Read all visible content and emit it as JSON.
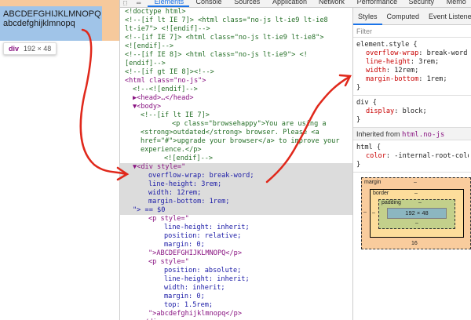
{
  "preview": {
    "line1": "ABCDEFGHIJKLMNOPQ",
    "line2": "abcdefghijklmnopq",
    "tooltip_tag": "div",
    "tooltip_size": "192 × 48"
  },
  "tabs": [
    "Elements",
    "Console",
    "Sources",
    "Application",
    "Network",
    "Performance",
    "Security",
    "Memo"
  ],
  "active_tab": "Elements",
  "dom_lines": [
    {
      "t": "<!doctype html>",
      "c": "cmt",
      "i": 0
    },
    {
      "t": "<!--[if lt IE 7]>      <html class=\"no-js lt-ie9 lt-ie8",
      "c": "cmt",
      "i": 0
    },
    {
      "t": "lt-ie7\"> <![endif]-->",
      "c": "cmt",
      "i": 0
    },
    {
      "t": "<!--[if IE 7]>         <html class=\"no-js lt-ie9 lt-ie8\">",
      "c": "cmt",
      "i": 0
    },
    {
      "t": "<![endif]-->",
      "c": "cmt",
      "i": 0
    },
    {
      "t": "<!--[if IE 8]>         <html class=\"no-js lt-ie9\"> <!",
      "c": "cmt",
      "i": 0
    },
    {
      "t": "[endif]-->",
      "c": "cmt",
      "i": 0
    },
    {
      "t": "<!--[if gt IE 8]><!-->",
      "c": "cmt",
      "i": 0
    },
    {
      "t": "<html class=\"no-js\">",
      "c": "tag",
      "i": 0
    },
    {
      "t": "<!--<![endif]-->",
      "c": "cmt",
      "i": 1
    },
    {
      "t": "▶<head>…</head>",
      "c": "tag",
      "i": 1
    },
    {
      "t": "▼<body>",
      "c": "tag",
      "i": 1
    },
    {
      "t": "<!--[if lt IE 7]>",
      "c": "cmt",
      "i": 2
    },
    {
      "t": "<p class=\"browsehappy\">You are using a",
      "c": "cmt",
      "i": 6
    },
    {
      "t": "<strong>outdated</strong> browser. Please <a",
      "c": "cmt",
      "i": 2
    },
    {
      "t": "href=\"#\">upgrade your browser</a> to improve your",
      "c": "cmt",
      "i": 2
    },
    {
      "t": "experience.</p>",
      "c": "cmt",
      "i": 2
    },
    {
      "t": "<![endif]-->",
      "c": "cmt",
      "i": 5
    },
    {
      "t": "▼<div style=\"",
      "c": "tag",
      "i": 1,
      "sel": true
    },
    {
      "t": "overflow-wrap: break-word;",
      "c": "val",
      "i": 3,
      "sel": true
    },
    {
      "t": "line-height: 3rem;",
      "c": "val",
      "i": 3,
      "sel": true
    },
    {
      "t": "width: 12rem;",
      "c": "val",
      "i": 3,
      "sel": true
    },
    {
      "t": "margin-bottom: 1rem;",
      "c": "val",
      "i": 3,
      "sel": true
    },
    {
      "t": "\"> == $0",
      "c": "val",
      "i": 1,
      "sel": true
    },
    {
      "t": "<p style=\"",
      "c": "tag",
      "i": 3
    },
    {
      "t": "line-height: inherit;",
      "c": "val",
      "i": 5
    },
    {
      "t": "position: relative;",
      "c": "val",
      "i": 5
    },
    {
      "t": "margin: 0;",
      "c": "val",
      "i": 5
    },
    {
      "t": "\">ABCDEFGHIJKLMNOPQ</p>",
      "c": "tag",
      "i": 3
    },
    {
      "t": "<p style=\"",
      "c": "tag",
      "i": 3
    },
    {
      "t": "position: absolute;",
      "c": "val",
      "i": 5
    },
    {
      "t": "line-height: inherit;",
      "c": "val",
      "i": 5
    },
    {
      "t": "width: inherit;",
      "c": "val",
      "i": 5
    },
    {
      "t": "margin: 0;",
      "c": "val",
      "i": 5
    },
    {
      "t": "top: 1.5rem;",
      "c": "val",
      "i": 5
    },
    {
      "t": "\">abcdefghijklmnopq</p>",
      "c": "tag",
      "i": 3
    },
    {
      "t": "</div>",
      "c": "tag",
      "i": 2
    }
  ],
  "side_tabs": [
    "Styles",
    "Computed",
    "Event Listene"
  ],
  "filter_placeholder": "Filter",
  "rules": {
    "element_style": {
      "selector": "element.style {",
      "props": [
        {
          "p": "overflow-wrap",
          "v": "break-word;"
        },
        {
          "p": "line-height",
          "v": "3rem;"
        },
        {
          "p": "width",
          "v": "12rem;"
        },
        {
          "p": "margin-bottom",
          "v": "1rem;"
        }
      ],
      "close": "}"
    },
    "div_rule": {
      "selector": "div {",
      "props": [
        {
          "p": "display",
          "v": "block;"
        }
      ],
      "close": "}"
    },
    "inherited_label": "Inherited from",
    "inherited_from": "html.no-js",
    "html_rule": {
      "selector": "html {",
      "props": [
        {
          "p": "color",
          "v": "-internal-root-color;"
        }
      ],
      "close": "}"
    }
  },
  "box_model": {
    "margin_label": "margin",
    "margin_top": "–",
    "margin_bottom": "16",
    "margin_left": "–",
    "border_label": "border",
    "border_top": "–",
    "border_left": "–",
    "padding_label": "padding",
    "padding_top": "–",
    "padding_bottom": "–",
    "content": "192 × 48",
    "content_bottom": "–"
  },
  "colors": {
    "annotation_red": "#e0281b",
    "selection_bg": "#dcdcdc"
  }
}
